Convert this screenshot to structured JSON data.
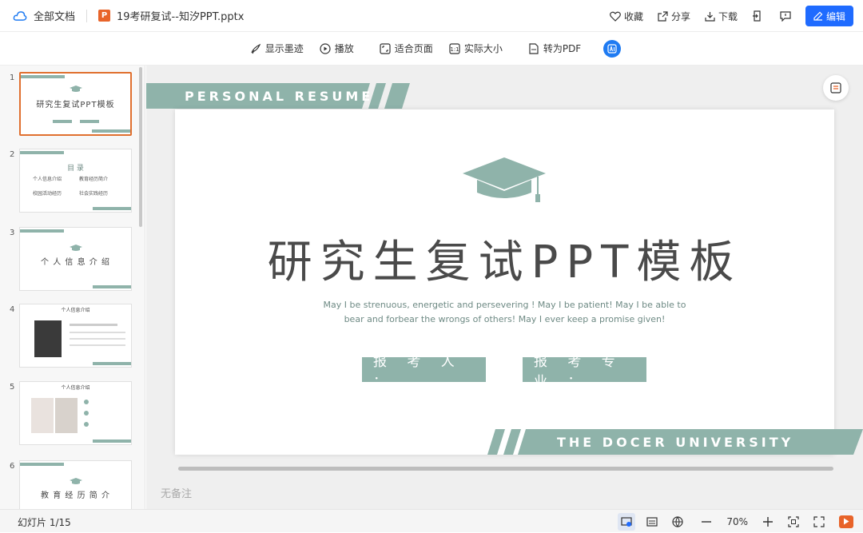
{
  "topbar": {
    "breadcrumb": "全部文档",
    "filename": "19考研复试--知汐PPT.pptx",
    "file_icon_letter": "P",
    "actions": [
      "收藏",
      "分享",
      "下载"
    ],
    "edit_label": "编辑",
    "icons": [
      "cloud-icon",
      "heart-icon",
      "share-icon",
      "download-icon",
      "export-icon",
      "comment-icon",
      "pencil-icon"
    ]
  },
  "toolbar": {
    "ink": "显示墨迹",
    "play": "播放",
    "fit": "适合页面",
    "actual": "实际大小",
    "pdf": "转为PDF"
  },
  "sidebar": {
    "thumbs": [
      {
        "num": "1",
        "title": "研究生复试PPT模板"
      },
      {
        "num": "2",
        "title": "目 录",
        "items": [
          "个人信息介绍",
          "教育经历简介",
          "校园活动经历",
          "社会实践经历"
        ]
      },
      {
        "num": "3",
        "title": "个 人 信 息 介 绍"
      },
      {
        "num": "4",
        "title": "个人信息介绍"
      },
      {
        "num": "5",
        "title": "个人信息介绍"
      },
      {
        "num": "6",
        "title": "教 育 经 历 简 介"
      }
    ]
  },
  "slide": {
    "top_band": "PERSONAL RESUME",
    "bottom_band": "THE DOCER UNIVERSITY",
    "title": "研究生复试PPT模板",
    "subtitle_line1": "May I be strenuous, energetic and persevering ! May I be patient! May I be able to",
    "subtitle_line2": "bear and forbear the wrongs of others! May I ever keep a promise given!",
    "applicant": "报 考 人 ：",
    "major": "报 考 专 业 ：",
    "accent_color": "#8fb3aa"
  },
  "notes_placeholder": "无备注",
  "status": {
    "slide_count": "幻灯片 1/15",
    "zoom": "70%"
  }
}
